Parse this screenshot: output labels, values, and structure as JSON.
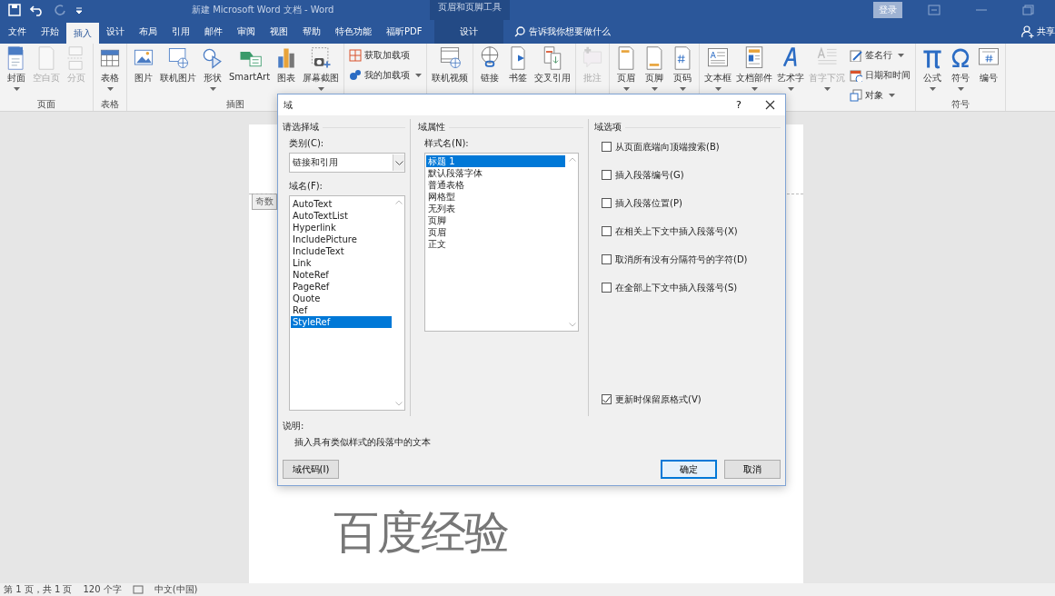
{
  "title_bar": {
    "title": "新建 Microsoft Word 文档  -  Word",
    "context_tool": "页眉和页脚工具",
    "login": "登录"
  },
  "menu_tabs": [
    {
      "label": "文件",
      "selected": false,
      "kind": "normal"
    },
    {
      "label": "开始",
      "selected": false,
      "kind": "normal"
    },
    {
      "label": "插入",
      "selected": true,
      "kind": "normal"
    },
    {
      "label": "设计",
      "selected": false,
      "kind": "normal"
    },
    {
      "label": "布局",
      "selected": false,
      "kind": "normal"
    },
    {
      "label": "引用",
      "selected": false,
      "kind": "normal"
    },
    {
      "label": "邮件",
      "selected": false,
      "kind": "normal"
    },
    {
      "label": "审阅",
      "selected": false,
      "kind": "normal"
    },
    {
      "label": "视图",
      "selected": false,
      "kind": "normal"
    },
    {
      "label": "帮助",
      "selected": false,
      "kind": "normal"
    },
    {
      "label": "特色功能",
      "selected": false,
      "kind": "normal"
    },
    {
      "label": "福昕PDF",
      "selected": false,
      "kind": "normal"
    },
    {
      "label": "设计",
      "selected": false,
      "kind": "context"
    }
  ],
  "tell_me": "告诉我你想要做什么",
  "share": "共享",
  "ribbon_groups": [
    {
      "label": "页面",
      "buttons": [
        {
          "label": "封面",
          "kind": "large",
          "disabled": false,
          "dropdown": true
        },
        {
          "label": "空白页",
          "kind": "large",
          "disabled": true,
          "dropdown": false
        },
        {
          "label": "分页",
          "kind": "large",
          "disabled": true,
          "dropdown": false
        }
      ]
    },
    {
      "label": "表格",
      "buttons": [
        {
          "label": "表格",
          "kind": "large",
          "disabled": false,
          "dropdown": true
        }
      ]
    },
    {
      "label": "插图",
      "buttons": [
        {
          "label": "图片",
          "kind": "large",
          "disabled": false,
          "dropdown": false
        },
        {
          "label": "联机图片",
          "kind": "large",
          "disabled": false,
          "dropdown": false
        },
        {
          "label": "形状",
          "kind": "large",
          "disabled": false,
          "dropdown": true
        },
        {
          "label": "SmartArt",
          "kind": "large",
          "disabled": false,
          "dropdown": false
        },
        {
          "label": "图表",
          "kind": "large",
          "disabled": false,
          "dropdown": false
        },
        {
          "label": "屏幕截图",
          "kind": "large",
          "disabled": false,
          "dropdown": true
        }
      ]
    },
    {
      "buttons": [
        {
          "label": "获取加载项",
          "kind": "small",
          "disabled": false,
          "dropdown": false
        },
        {
          "label": "我的加载项",
          "kind": "small",
          "disabled": false,
          "dropdown": true
        }
      ]
    },
    {
      "buttons": [
        {
          "label": "联机视频",
          "kind": "large",
          "disabled": false,
          "dropdown": false
        }
      ]
    },
    {
      "buttons": [
        {
          "label": "链接",
          "kind": "large",
          "disabled": false,
          "dropdown": false
        },
        {
          "label": "书签",
          "kind": "large",
          "disabled": false,
          "dropdown": false
        },
        {
          "label": "交叉引用",
          "kind": "large",
          "disabled": false,
          "dropdown": false
        }
      ]
    },
    {
      "buttons": [
        {
          "label": "批注",
          "kind": "large",
          "disabled": true,
          "dropdown": false
        }
      ]
    },
    {
      "buttons": [
        {
          "label": "页眉",
          "kind": "large",
          "disabled": false,
          "dropdown": true
        },
        {
          "label": "页脚",
          "kind": "large",
          "disabled": false,
          "dropdown": true
        },
        {
          "label": "页码",
          "kind": "large",
          "disabled": false,
          "dropdown": true
        }
      ]
    },
    {
      "buttons": [
        {
          "label": "文本框",
          "kind": "large",
          "disabled": false,
          "dropdown": true
        },
        {
          "label": "文档部件",
          "kind": "large",
          "disabled": false,
          "dropdown": true
        },
        {
          "label": "艺术字",
          "kind": "large",
          "disabled": false,
          "dropdown": true
        },
        {
          "label": "首字下沉",
          "kind": "large",
          "disabled": true,
          "dropdown": true
        },
        {
          "label": "签名行",
          "kind": "small",
          "disabled": false,
          "dropdown": true
        },
        {
          "label": "日期和时间",
          "kind": "small",
          "disabled": false,
          "dropdown": false
        },
        {
          "label": "对象",
          "kind": "small",
          "disabled": false,
          "dropdown": true
        }
      ]
    },
    {
      "label": "符号",
      "buttons": [
        {
          "label": "公式",
          "kind": "large",
          "disabled": false,
          "dropdown": true
        },
        {
          "label": "符号",
          "kind": "large",
          "disabled": false,
          "dropdown": true
        },
        {
          "label": "编号",
          "kind": "large",
          "disabled": false,
          "dropdown": false
        }
      ]
    }
  ],
  "document": {
    "header_tag": "奇数",
    "heading": "百度经验"
  },
  "dialog": {
    "title": "域",
    "help": "?",
    "choose_section": "请选择域",
    "category_label": "类别(C):",
    "category_value": "链接和引用",
    "fields_label": "域名(F):",
    "fields": [
      {
        "label": "AutoText",
        "selected": false
      },
      {
        "label": "AutoTextList",
        "selected": false
      },
      {
        "label": "Hyperlink",
        "selected": false
      },
      {
        "label": "IncludePicture",
        "selected": false
      },
      {
        "label": "IncludeText",
        "selected": false
      },
      {
        "label": "Link",
        "selected": false
      },
      {
        "label": "NoteRef",
        "selected": false
      },
      {
        "label": "PageRef",
        "selected": false
      },
      {
        "label": "Quote",
        "selected": false
      },
      {
        "label": "Ref",
        "selected": false
      },
      {
        "label": "StyleRef",
        "selected": true
      }
    ],
    "properties_section": "域属性",
    "style_label": "样式名(N):",
    "styles": [
      {
        "label": "标题 1",
        "selected": true
      },
      {
        "label": "默认段落字体",
        "selected": false
      },
      {
        "label": "普通表格",
        "selected": false
      },
      {
        "label": "网格型",
        "selected": false
      },
      {
        "label": "无列表",
        "selected": false
      },
      {
        "label": "页脚",
        "selected": false
      },
      {
        "label": "页眉",
        "selected": false
      },
      {
        "label": "正文",
        "selected": false
      }
    ],
    "options_section": "域选项",
    "options": [
      {
        "label": "从页面底端向顶端搜索(B)",
        "checked": false
      },
      {
        "label": "插入段落编号(G)",
        "checked": false
      },
      {
        "label": "插入段落位置(P)",
        "checked": false
      },
      {
        "label": "在相关上下文中插入段落号(X)",
        "checked": false
      },
      {
        "label": "取消所有没有分隔符号的字符(D)",
        "checked": false
      },
      {
        "label": "在全部上下文中插入段落号(S)",
        "checked": false
      }
    ],
    "preserve_option": {
      "label": "更新时保留原格式(V)",
      "checked": true
    },
    "description_label": "说明:",
    "description": "插入具有类似样式的段落中的文本",
    "field_codes_button": "域代码(I)",
    "ok_button": "确定",
    "cancel_button": "取消"
  },
  "status_bar": {
    "page": "第 1 页，共 1 页",
    "words": "120 个字",
    "language": "中文(中国)"
  }
}
